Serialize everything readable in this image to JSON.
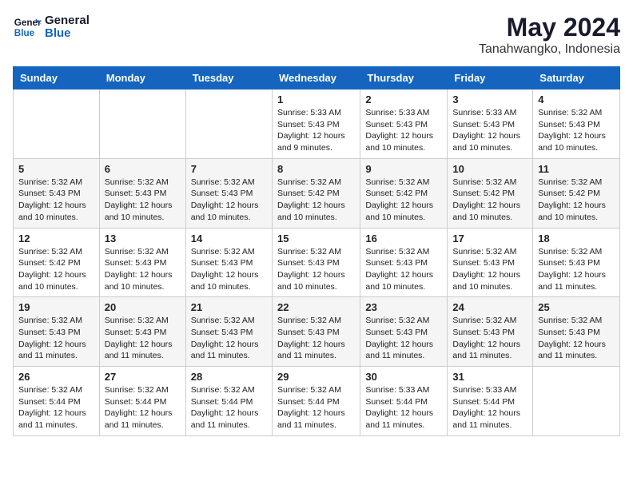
{
  "header": {
    "logo_line1": "General",
    "logo_line2": "Blue",
    "month_title": "May 2024",
    "location": "Tanahwangko, Indonesia"
  },
  "weekdays": [
    "Sunday",
    "Monday",
    "Tuesday",
    "Wednesday",
    "Thursday",
    "Friday",
    "Saturday"
  ],
  "weeks": [
    [
      {
        "day": "",
        "sunrise": "",
        "sunset": "",
        "daylight": ""
      },
      {
        "day": "",
        "sunrise": "",
        "sunset": "",
        "daylight": ""
      },
      {
        "day": "",
        "sunrise": "",
        "sunset": "",
        "daylight": ""
      },
      {
        "day": "1",
        "sunrise": "Sunrise: 5:33 AM",
        "sunset": "Sunset: 5:43 PM",
        "daylight": "Daylight: 12 hours and 9 minutes."
      },
      {
        "day": "2",
        "sunrise": "Sunrise: 5:33 AM",
        "sunset": "Sunset: 5:43 PM",
        "daylight": "Daylight: 12 hours and 10 minutes."
      },
      {
        "day": "3",
        "sunrise": "Sunrise: 5:33 AM",
        "sunset": "Sunset: 5:43 PM",
        "daylight": "Daylight: 12 hours and 10 minutes."
      },
      {
        "day": "4",
        "sunrise": "Sunrise: 5:32 AM",
        "sunset": "Sunset: 5:43 PM",
        "daylight": "Daylight: 12 hours and 10 minutes."
      }
    ],
    [
      {
        "day": "5",
        "sunrise": "Sunrise: 5:32 AM",
        "sunset": "Sunset: 5:43 PM",
        "daylight": "Daylight: 12 hours and 10 minutes."
      },
      {
        "day": "6",
        "sunrise": "Sunrise: 5:32 AM",
        "sunset": "Sunset: 5:43 PM",
        "daylight": "Daylight: 12 hours and 10 minutes."
      },
      {
        "day": "7",
        "sunrise": "Sunrise: 5:32 AM",
        "sunset": "Sunset: 5:43 PM",
        "daylight": "Daylight: 12 hours and 10 minutes."
      },
      {
        "day": "8",
        "sunrise": "Sunrise: 5:32 AM",
        "sunset": "Sunset: 5:42 PM",
        "daylight": "Daylight: 12 hours and 10 minutes."
      },
      {
        "day": "9",
        "sunrise": "Sunrise: 5:32 AM",
        "sunset": "Sunset: 5:42 PM",
        "daylight": "Daylight: 12 hours and 10 minutes."
      },
      {
        "day": "10",
        "sunrise": "Sunrise: 5:32 AM",
        "sunset": "Sunset: 5:42 PM",
        "daylight": "Daylight: 12 hours and 10 minutes."
      },
      {
        "day": "11",
        "sunrise": "Sunrise: 5:32 AM",
        "sunset": "Sunset: 5:42 PM",
        "daylight": "Daylight: 12 hours and 10 minutes."
      }
    ],
    [
      {
        "day": "12",
        "sunrise": "Sunrise: 5:32 AM",
        "sunset": "Sunset: 5:42 PM",
        "daylight": "Daylight: 12 hours and 10 minutes."
      },
      {
        "day": "13",
        "sunrise": "Sunrise: 5:32 AM",
        "sunset": "Sunset: 5:43 PM",
        "daylight": "Daylight: 12 hours and 10 minutes."
      },
      {
        "day": "14",
        "sunrise": "Sunrise: 5:32 AM",
        "sunset": "Sunset: 5:43 PM",
        "daylight": "Daylight: 12 hours and 10 minutes."
      },
      {
        "day": "15",
        "sunrise": "Sunrise: 5:32 AM",
        "sunset": "Sunset: 5:43 PM",
        "daylight": "Daylight: 12 hours and 10 minutes."
      },
      {
        "day": "16",
        "sunrise": "Sunrise: 5:32 AM",
        "sunset": "Sunset: 5:43 PM",
        "daylight": "Daylight: 12 hours and 10 minutes."
      },
      {
        "day": "17",
        "sunrise": "Sunrise: 5:32 AM",
        "sunset": "Sunset: 5:43 PM",
        "daylight": "Daylight: 12 hours and 10 minutes."
      },
      {
        "day": "18",
        "sunrise": "Sunrise: 5:32 AM",
        "sunset": "Sunset: 5:43 PM",
        "daylight": "Daylight: 12 hours and 11 minutes."
      }
    ],
    [
      {
        "day": "19",
        "sunrise": "Sunrise: 5:32 AM",
        "sunset": "Sunset: 5:43 PM",
        "daylight": "Daylight: 12 hours and 11 minutes."
      },
      {
        "day": "20",
        "sunrise": "Sunrise: 5:32 AM",
        "sunset": "Sunset: 5:43 PM",
        "daylight": "Daylight: 12 hours and 11 minutes."
      },
      {
        "day": "21",
        "sunrise": "Sunrise: 5:32 AM",
        "sunset": "Sunset: 5:43 PM",
        "daylight": "Daylight: 12 hours and 11 minutes."
      },
      {
        "day": "22",
        "sunrise": "Sunrise: 5:32 AM",
        "sunset": "Sunset: 5:43 PM",
        "daylight": "Daylight: 12 hours and 11 minutes."
      },
      {
        "day": "23",
        "sunrise": "Sunrise: 5:32 AM",
        "sunset": "Sunset: 5:43 PM",
        "daylight": "Daylight: 12 hours and 11 minutes."
      },
      {
        "day": "24",
        "sunrise": "Sunrise: 5:32 AM",
        "sunset": "Sunset: 5:43 PM",
        "daylight": "Daylight: 12 hours and 11 minutes."
      },
      {
        "day": "25",
        "sunrise": "Sunrise: 5:32 AM",
        "sunset": "Sunset: 5:43 PM",
        "daylight": "Daylight: 12 hours and 11 minutes."
      }
    ],
    [
      {
        "day": "26",
        "sunrise": "Sunrise: 5:32 AM",
        "sunset": "Sunset: 5:44 PM",
        "daylight": "Daylight: 12 hours and 11 minutes."
      },
      {
        "day": "27",
        "sunrise": "Sunrise: 5:32 AM",
        "sunset": "Sunset: 5:44 PM",
        "daylight": "Daylight: 12 hours and 11 minutes."
      },
      {
        "day": "28",
        "sunrise": "Sunrise: 5:32 AM",
        "sunset": "Sunset: 5:44 PM",
        "daylight": "Daylight: 12 hours and 11 minutes."
      },
      {
        "day": "29",
        "sunrise": "Sunrise: 5:32 AM",
        "sunset": "Sunset: 5:44 PM",
        "daylight": "Daylight: 12 hours and 11 minutes."
      },
      {
        "day": "30",
        "sunrise": "Sunrise: 5:33 AM",
        "sunset": "Sunset: 5:44 PM",
        "daylight": "Daylight: 12 hours and 11 minutes."
      },
      {
        "day": "31",
        "sunrise": "Sunrise: 5:33 AM",
        "sunset": "Sunset: 5:44 PM",
        "daylight": "Daylight: 12 hours and 11 minutes."
      },
      {
        "day": "",
        "sunrise": "",
        "sunset": "",
        "daylight": ""
      }
    ]
  ]
}
